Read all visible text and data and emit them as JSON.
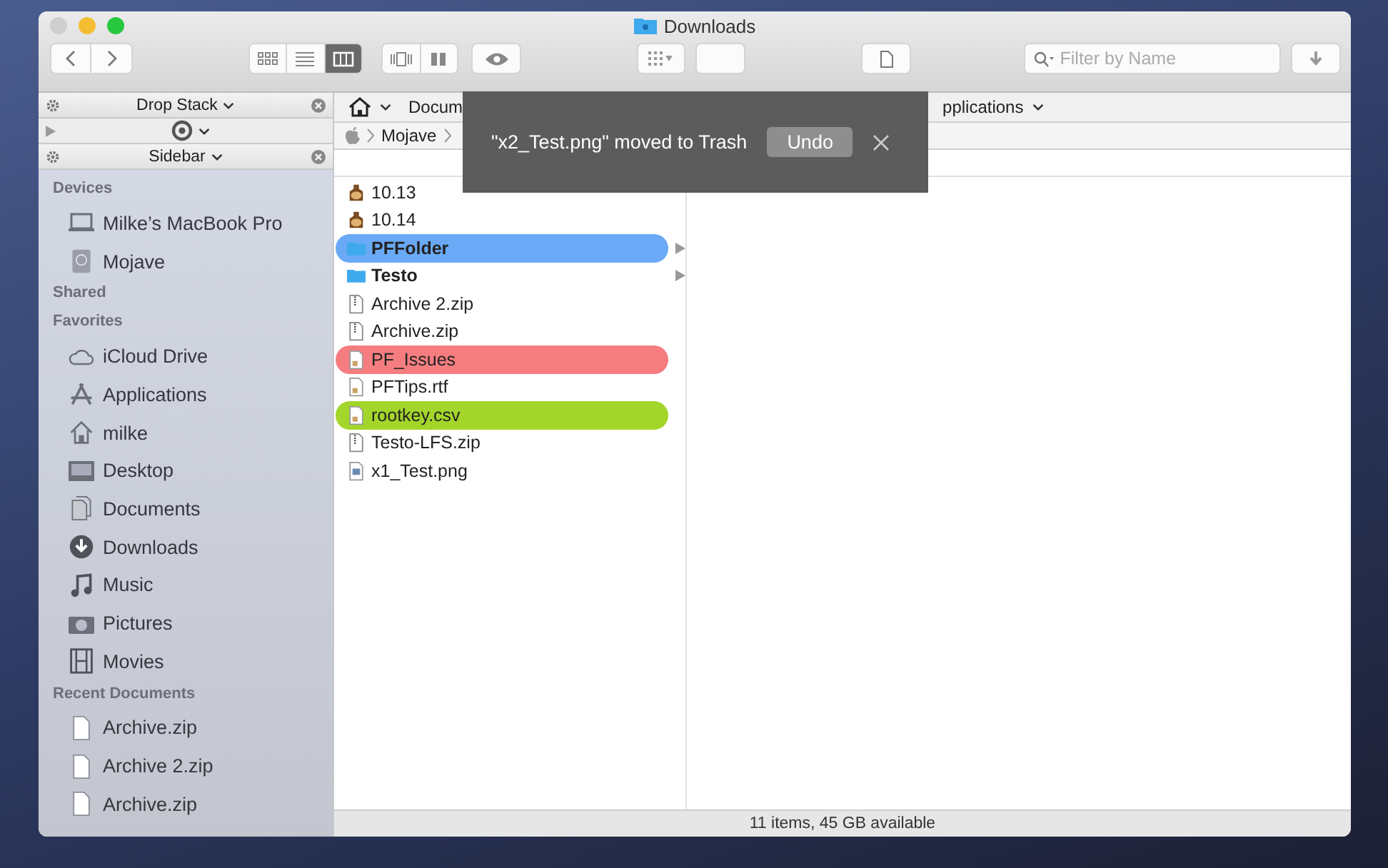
{
  "window": {
    "title": "Downloads"
  },
  "toolbar": {
    "views": [
      {
        "kind": "icons",
        "selected": false
      },
      {
        "kind": "list",
        "selected": false
      },
      {
        "kind": "columns",
        "selected": true
      }
    ],
    "search": {
      "placeholder": "Filter by Name"
    }
  },
  "drop_stack": {
    "title": "Drop Stack"
  },
  "sidebar_panel": {
    "title": "Sidebar"
  },
  "sidebar": [
    {
      "heading": "Devices",
      "items": [
        {
          "label": "Milke’s MacBook Pro",
          "kind": "laptop"
        },
        {
          "label": "Mojave",
          "kind": "disk"
        }
      ]
    },
    {
      "heading": "Shared"
    },
    {
      "heading": "Favorites",
      "items": [
        {
          "label": "iCloud Drive",
          "kind": "cloud"
        },
        {
          "label": "Applications",
          "kind": "apps"
        },
        {
          "label": "milke",
          "kind": "home"
        },
        {
          "label": "Desktop",
          "kind": "desktop"
        },
        {
          "label": "Documents",
          "kind": "docs"
        },
        {
          "label": "Downloads",
          "kind": "download"
        },
        {
          "label": "Music",
          "kind": "music"
        },
        {
          "label": "Pictures",
          "kind": "camera"
        },
        {
          "label": "Movies",
          "kind": "film"
        }
      ]
    },
    {
      "heading": "Recent Documents",
      "items": [
        {
          "label": "Archive.zip",
          "kind": "file"
        },
        {
          "label": "Archive 2.zip",
          "kind": "file"
        },
        {
          "label": "Archive.zip",
          "kind": "file"
        }
      ]
    }
  ],
  "favorites_bar": [
    "Docum",
    "pplications"
  ],
  "path": [
    "Mojave"
  ],
  "files": [
    {
      "name": "10.13",
      "kind": "app"
    },
    {
      "name": "10.14",
      "kind": "app"
    },
    {
      "name": "PFFolder",
      "kind": "folder",
      "color": "#6aa9f5"
    },
    {
      "name": "Testo",
      "kind": "folder"
    },
    {
      "name": "Archive 2.zip",
      "kind": "zip"
    },
    {
      "name": "Archive.zip",
      "kind": "zip"
    },
    {
      "name": "PF_Issues",
      "kind": "doc",
      "color": "#f57d80"
    },
    {
      "name": "PFTips.rtf",
      "kind": "doc"
    },
    {
      "name": "rootkey.csv",
      "kind": "doc",
      "color": "#a3d62a"
    },
    {
      "name": "Testo-LFS.zip",
      "kind": "zip"
    },
    {
      "name": "x1_Test.png",
      "kind": "image"
    }
  ],
  "toast": {
    "message": "\"x2_Test.png\" moved to Trash",
    "button": "Undo"
  },
  "status_bar": "11 items, 45 GB available"
}
